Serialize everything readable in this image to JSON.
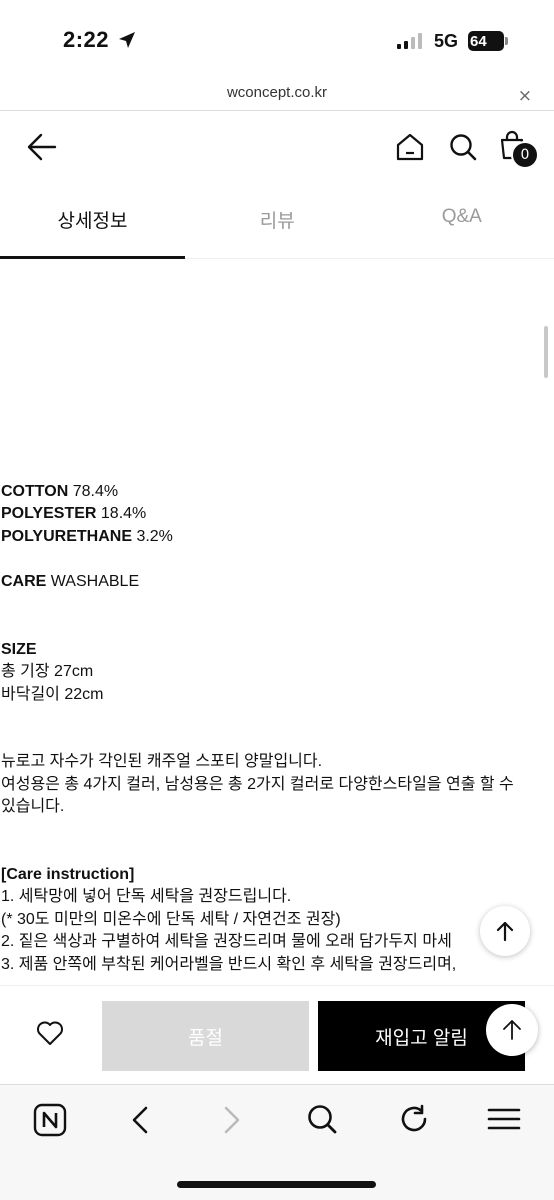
{
  "status_bar": {
    "time": "2:22",
    "network": "5G",
    "battery": "64"
  },
  "browser": {
    "url": "wconcept.co.kr",
    "close_icon": "×"
  },
  "header": {
    "cart_count": "0"
  },
  "tabs": [
    {
      "label": "상세정보",
      "active": true
    },
    {
      "label": "리뷰",
      "active": false
    },
    {
      "label": "Q&A",
      "active": false
    }
  ],
  "detail": {
    "composition": [
      {
        "name": "COTTON",
        "value": "78.4%"
      },
      {
        "name": "POLYESTER",
        "value": "18.4%"
      },
      {
        "name": "POLYURETHANE",
        "value": "3.2%"
      }
    ],
    "care_label": "CARE",
    "care_value": "WASHABLE",
    "size_label": "SIZE",
    "size_lines": [
      "총 기장 27cm",
      "바닥길이 22cm"
    ],
    "description": [
      "뉴로고 자수가 각인된 캐주얼 스포티 양말입니다.",
      "여성용은 총 4가지 컬러, 남성용은 총 2가지 컬러로 다양한스타일을 연출 할 수",
      "있습니다."
    ],
    "care_instruction_title": "[Care instruction]",
    "care_instructions": [
      "1. 세탁망에 넣어 단독 세탁을 권장드립니다.",
      "(* 30도 미만의 미온수에 단독 세탁 / 자연건조 권장)",
      "2. 짙은 색상과 구별하여 세탁을 권장드리며 물에 오래 담가두지 마세",
      "3. 제품 안쪽에 부착된 케어라벨을 반드시 확인 후 세탁을 권장드리며,"
    ]
  },
  "actions": {
    "soldout_label": "품절",
    "restock_label": "재입고 알림"
  }
}
